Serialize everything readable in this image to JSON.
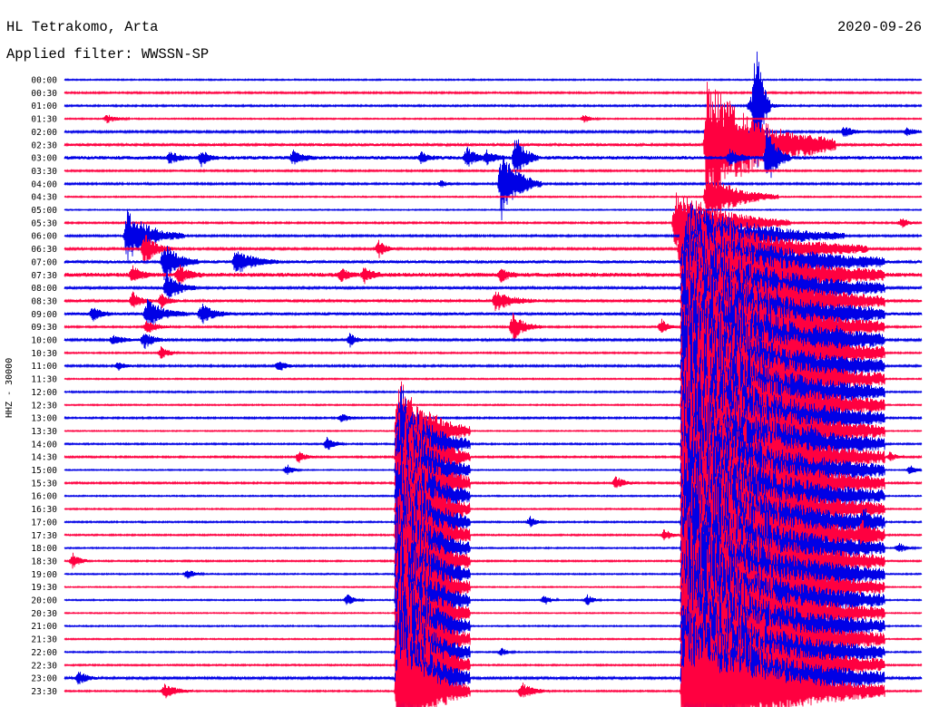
{
  "header": {
    "station": "HL Tetrakomo, Arta",
    "date": "2020-09-26",
    "filter": "Applied filter: WWSSN-SP"
  },
  "chart_data": {
    "type": "line",
    "ylabel": "HHZ - 30000",
    "colors": [
      "#0000e6",
      "#ff0040"
    ],
    "x_range_minutes": [
      0,
      30
    ],
    "rows": [
      "00:00",
      "00:30",
      "01:00",
      "01:30",
      "02:00",
      "02:30",
      "03:00",
      "03:30",
      "04:00",
      "04:30",
      "05:00",
      "05:30",
      "06:00",
      "06:30",
      "07:00",
      "07:30",
      "08:00",
      "08:30",
      "09:00",
      "09:30",
      "10:00",
      "10:30",
      "11:00",
      "11:30",
      "12:00",
      "12:30",
      "13:00",
      "13:30",
      "14:00",
      "14:30",
      "15:00",
      "15:30",
      "16:00",
      "16:30",
      "17:00",
      "17:30",
      "18:00",
      "18:30",
      "19:00",
      "19:30",
      "20:00",
      "20:30",
      "21:00",
      "21:30",
      "22:00",
      "22:30",
      "23:00",
      "23:30"
    ],
    "noise": [
      0.7,
      0.9,
      0.9,
      0.7,
      1.1,
      1.5,
      1.9,
      0.9,
      1.0,
      0.7,
      0.6,
      0.9,
      1.0,
      1.1,
      1.6,
      2.2,
      1.3,
      1.4,
      1.6,
      0.9,
      1.1,
      0.8,
      1.0,
      0.7,
      0.8,
      0.7,
      0.9,
      0.6,
      0.8,
      0.9,
      0.6,
      0.9,
      0.7,
      0.7,
      0.8,
      0.8,
      0.7,
      0.8,
      0.7,
      0.6,
      0.7,
      0.6,
      0.7,
      0.7,
      0.7,
      0.8,
      1.2,
      0.8
    ],
    "events": [
      {
        "row": 2,
        "minute": 24.0,
        "amplitude": 10,
        "duration_minutes": 1.2
      },
      {
        "row": 2,
        "minute": 24.2,
        "amplitude": 85,
        "duration_minutes": 0.5
      },
      {
        "row": 3,
        "minute": 1.5,
        "amplitude": 5,
        "duration_minutes": 0.8
      },
      {
        "row": 3,
        "minute": 18.2,
        "amplitude": 5,
        "duration_minutes": 0.5
      },
      {
        "row": 4,
        "minute": 27.3,
        "amplitude": 6,
        "duration_minutes": 0.8
      },
      {
        "row": 4,
        "minute": 29.5,
        "amplitude": 5,
        "duration_minutes": 0.6
      },
      {
        "row": 5,
        "minute": 26.0,
        "amplitude": 4,
        "duration_minutes": 1.0
      },
      {
        "row": 5,
        "minute": 22.5,
        "amplitude": 75,
        "duration_minutes": 4.5
      },
      {
        "row": 6,
        "minute": 8.0,
        "amplitude": 8,
        "duration_minutes": 0.8
      },
      {
        "row": 6,
        "minute": 15.8,
        "amplitude": 26,
        "duration_minutes": 0.8
      },
      {
        "row": 6,
        "minute": 14.8,
        "amplitude": 9,
        "duration_minutes": 0.6
      },
      {
        "row": 6,
        "minute": 14.1,
        "amplitude": 12,
        "duration_minutes": 0.7
      },
      {
        "row": 6,
        "minute": 12.5,
        "amplitude": 6,
        "duration_minutes": 0.6
      },
      {
        "row": 6,
        "minute": 3.7,
        "amplitude": 7,
        "duration_minutes": 0.7
      },
      {
        "row": 6,
        "minute": 4.8,
        "amplitude": 9,
        "duration_minutes": 0.6
      },
      {
        "row": 6,
        "minute": 23.3,
        "amplitude": 10,
        "duration_minutes": 0.7
      },
      {
        "row": 6,
        "minute": 24.6,
        "amplitude": 36,
        "duration_minutes": 0.8
      },
      {
        "row": 8,
        "minute": 15.3,
        "amplitude": 40,
        "duration_minutes": 1.4
      },
      {
        "row": 8,
        "minute": 13.2,
        "amplitude": 4,
        "duration_minutes": 0.4
      },
      {
        "row": 9,
        "minute": 22.5,
        "amplitude": 30,
        "duration_minutes": 2.5
      },
      {
        "row": 11,
        "minute": 21.4,
        "amplitude": 40,
        "duration_minutes": 4.0
      },
      {
        "row": 11,
        "minute": 29.3,
        "amplitude": 6,
        "duration_minutes": 0.5
      },
      {
        "row": 12,
        "minute": 2.2,
        "amplitude": 30,
        "duration_minutes": 2.0
      },
      {
        "row": 12,
        "minute": 21.8,
        "amplitude": 40,
        "duration_minutes": 5.5
      },
      {
        "row": 13,
        "minute": 2.8,
        "amplitude": 18,
        "duration_minutes": 1.0
      },
      {
        "row": 13,
        "minute": 11.0,
        "amplitude": 10,
        "duration_minutes": 0.6
      },
      {
        "row": 13,
        "minute": 21.6,
        "amplitude": 50,
        "duration_minutes": 6.5
      },
      {
        "row": 14,
        "minute": 3.5,
        "amplitude": 22,
        "duration_minutes": 1.2
      },
      {
        "row": 14,
        "minute": 6.0,
        "amplitude": 14,
        "duration_minutes": 1.5
      },
      {
        "row": 14,
        "minute": 21.7,
        "amplitude": 55,
        "duration_minutes": 7.0
      },
      {
        "row": 15,
        "minute": 2.4,
        "amplitude": 10,
        "duration_minutes": 0.7
      },
      {
        "row": 15,
        "minute": 4.0,
        "amplitude": 12,
        "duration_minutes": 0.8
      },
      {
        "row": 15,
        "minute": 9.7,
        "amplitude": 8,
        "duration_minutes": 0.6
      },
      {
        "row": 15,
        "minute": 10.5,
        "amplitude": 9,
        "duration_minutes": 0.6
      },
      {
        "row": 15,
        "minute": 15.3,
        "amplitude": 8,
        "duration_minutes": 0.6
      },
      {
        "row": 15,
        "minute": 21.7,
        "amplitude": 60,
        "duration_minutes": 7.0
      },
      {
        "row": 16,
        "minute": 3.6,
        "amplitude": 18,
        "duration_minutes": 1.0
      },
      {
        "row": 16,
        "minute": 21.7,
        "amplitude": 65,
        "duration_minutes": 7.0
      },
      {
        "row": 17,
        "minute": 2.4,
        "amplitude": 10,
        "duration_minutes": 0.7
      },
      {
        "row": 17,
        "minute": 3.4,
        "amplitude": 8,
        "duration_minutes": 0.6
      },
      {
        "row": 17,
        "minute": 15.1,
        "amplitude": 12,
        "duration_minutes": 1.4
      },
      {
        "row": 17,
        "minute": 21.7,
        "amplitude": 70,
        "duration_minutes": 7.0
      },
      {
        "row": 18,
        "minute": 1.0,
        "amplitude": 8,
        "duration_minutes": 0.7
      },
      {
        "row": 18,
        "minute": 2.9,
        "amplitude": 16,
        "duration_minutes": 1.4
      },
      {
        "row": 18,
        "minute": 4.8,
        "amplitude": 12,
        "duration_minutes": 1.0
      },
      {
        "row": 18,
        "minute": 21.7,
        "amplitude": 75,
        "duration_minutes": 7.0
      },
      {
        "row": 19,
        "minute": 2.9,
        "amplitude": 8,
        "duration_minutes": 0.8
      },
      {
        "row": 19,
        "minute": 15.7,
        "amplitude": 16,
        "duration_minutes": 1.0
      },
      {
        "row": 19,
        "minute": 20.9,
        "amplitude": 9,
        "duration_minutes": 0.5
      },
      {
        "row": 19,
        "minute": 21.7,
        "amplitude": 80,
        "duration_minutes": 7.0
      },
      {
        "row": 20,
        "minute": 1.7,
        "amplitude": 6,
        "duration_minutes": 1.0
      },
      {
        "row": 20,
        "minute": 2.8,
        "amplitude": 10,
        "duration_minutes": 0.8
      },
      {
        "row": 20,
        "minute": 10.0,
        "amplitude": 8,
        "duration_minutes": 0.5
      },
      {
        "row": 20,
        "minute": 21.7,
        "amplitude": 85,
        "duration_minutes": 7.0
      },
      {
        "row": 20,
        "minute": 27.0,
        "amplitude": 6,
        "duration_minutes": 0.6
      },
      {
        "row": 21,
        "minute": 3.4,
        "amplitude": 8,
        "duration_minutes": 0.6
      },
      {
        "row": 21,
        "minute": 21.7,
        "amplitude": 85,
        "duration_minutes": 7.0
      },
      {
        "row": 22,
        "minute": 1.9,
        "amplitude": 5,
        "duration_minutes": 0.5
      },
      {
        "row": 22,
        "minute": 7.5,
        "amplitude": 7,
        "duration_minutes": 0.6
      },
      {
        "row": 22,
        "minute": 21.7,
        "amplitude": 85,
        "duration_minutes": 7.0
      },
      {
        "row": 23,
        "minute": 21.7,
        "amplitude": 85,
        "duration_minutes": 7.0
      },
      {
        "row": 24,
        "minute": 21.7,
        "amplitude": 85,
        "duration_minutes": 7.0
      },
      {
        "row": 25,
        "minute": 21.7,
        "amplitude": 85,
        "duration_minutes": 7.0
      },
      {
        "row": 26,
        "minute": 9.7,
        "amplitude": 6,
        "duration_minutes": 0.6
      },
      {
        "row": 26,
        "minute": 21.7,
        "amplitude": 85,
        "duration_minutes": 7.0
      },
      {
        "row": 27,
        "minute": 11.7,
        "amplitude": 70,
        "duration_minutes": 2.5
      },
      {
        "row": 27,
        "minute": 21.7,
        "amplitude": 85,
        "duration_minutes": 7.0
      },
      {
        "row": 28,
        "minute": 9.2,
        "amplitude": 8,
        "duration_minutes": 0.6
      },
      {
        "row": 28,
        "minute": 11.7,
        "amplitude": 70,
        "duration_minutes": 2.5
      },
      {
        "row": 28,
        "minute": 21.7,
        "amplitude": 85,
        "duration_minutes": 7.0
      },
      {
        "row": 28,
        "minute": 26.1,
        "amplitude": 8,
        "duration_minutes": 0.5
      },
      {
        "row": 29,
        "minute": 8.2,
        "amplitude": 7,
        "duration_minutes": 0.6
      },
      {
        "row": 29,
        "minute": 11.7,
        "amplitude": 75,
        "duration_minutes": 2.5
      },
      {
        "row": 29,
        "minute": 21.7,
        "amplitude": 85,
        "duration_minutes": 7.0
      },
      {
        "row": 29,
        "minute": 28.9,
        "amplitude": 6,
        "duration_minutes": 0.5
      },
      {
        "row": 30,
        "minute": 7.8,
        "amplitude": 7,
        "duration_minutes": 0.5
      },
      {
        "row": 30,
        "minute": 11.7,
        "amplitude": 80,
        "duration_minutes": 2.5
      },
      {
        "row": 30,
        "minute": 21.7,
        "amplitude": 85,
        "duration_minutes": 7.0
      },
      {
        "row": 30,
        "minute": 29.6,
        "amplitude": 6,
        "duration_minutes": 0.5
      },
      {
        "row": 31,
        "minute": 11.7,
        "amplitude": 85,
        "duration_minutes": 2.5
      },
      {
        "row": 31,
        "minute": 19.3,
        "amplitude": 8,
        "duration_minutes": 0.7
      },
      {
        "row": 31,
        "minute": 21.7,
        "amplitude": 85,
        "duration_minutes": 7.0
      },
      {
        "row": 32,
        "minute": 11.7,
        "amplitude": 85,
        "duration_minutes": 2.5
      },
      {
        "row": 32,
        "minute": 21.7,
        "amplitude": 85,
        "duration_minutes": 7.0
      },
      {
        "row": 33,
        "minute": 11.7,
        "amplitude": 85,
        "duration_minutes": 2.5
      },
      {
        "row": 33,
        "minute": 21.7,
        "amplitude": 85,
        "duration_minutes": 7.0
      },
      {
        "row": 34,
        "minute": 11.7,
        "amplitude": 85,
        "duration_minutes": 2.5
      },
      {
        "row": 34,
        "minute": 16.3,
        "amplitude": 6,
        "duration_minutes": 0.5
      },
      {
        "row": 34,
        "minute": 21.7,
        "amplitude": 85,
        "duration_minutes": 7.0
      },
      {
        "row": 34,
        "minute": 28.0,
        "amplitude": 8,
        "duration_minutes": 0.7
      },
      {
        "row": 35,
        "minute": 11.7,
        "amplitude": 85,
        "duration_minutes": 2.5
      },
      {
        "row": 35,
        "minute": 21.0,
        "amplitude": 7,
        "duration_minutes": 0.6
      },
      {
        "row": 35,
        "minute": 21.7,
        "amplitude": 85,
        "duration_minutes": 7.0
      },
      {
        "row": 35,
        "minute": 27.9,
        "amplitude": 9,
        "duration_minutes": 0.8
      },
      {
        "row": 36,
        "minute": 11.7,
        "amplitude": 85,
        "duration_minutes": 2.5
      },
      {
        "row": 36,
        "minute": 21.7,
        "amplitude": 85,
        "duration_minutes": 7.0
      },
      {
        "row": 36,
        "minute": 29.2,
        "amplitude": 6,
        "duration_minutes": 0.6
      },
      {
        "row": 37,
        "minute": 0.3,
        "amplitude": 9,
        "duration_minutes": 0.6
      },
      {
        "row": 37,
        "minute": 11.7,
        "amplitude": 85,
        "duration_minutes": 2.5
      },
      {
        "row": 37,
        "minute": 21.7,
        "amplitude": 85,
        "duration_minutes": 7.0
      },
      {
        "row": 38,
        "minute": 4.3,
        "amplitude": 6,
        "duration_minutes": 0.6
      },
      {
        "row": 38,
        "minute": 11.7,
        "amplitude": 85,
        "duration_minutes": 2.5
      },
      {
        "row": 38,
        "minute": 21.7,
        "amplitude": 85,
        "duration_minutes": 7.0
      },
      {
        "row": 39,
        "minute": 11.7,
        "amplitude": 85,
        "duration_minutes": 2.5
      },
      {
        "row": 39,
        "minute": 21.7,
        "amplitude": 85,
        "duration_minutes": 7.0
      },
      {
        "row": 40,
        "minute": 9.9,
        "amplitude": 7,
        "duration_minutes": 0.6
      },
      {
        "row": 40,
        "minute": 11.7,
        "amplitude": 85,
        "duration_minutes": 2.5
      },
      {
        "row": 40,
        "minute": 16.8,
        "amplitude": 6,
        "duration_minutes": 0.5
      },
      {
        "row": 40,
        "minute": 18.3,
        "amplitude": 6,
        "duration_minutes": 0.5
      },
      {
        "row": 40,
        "minute": 21.7,
        "amplitude": 85,
        "duration_minutes": 7.0
      },
      {
        "row": 41,
        "minute": 11.7,
        "amplitude": 85,
        "duration_minutes": 2.5
      },
      {
        "row": 41,
        "minute": 21.7,
        "amplitude": 85,
        "duration_minutes": 7.0
      },
      {
        "row": 42,
        "minute": 11.7,
        "amplitude": 85,
        "duration_minutes": 2.5
      },
      {
        "row": 42,
        "minute": 21.7,
        "amplitude": 85,
        "duration_minutes": 7.0
      },
      {
        "row": 43,
        "minute": 11.7,
        "amplitude": 85,
        "duration_minutes": 2.5
      },
      {
        "row": 43,
        "minute": 21.7,
        "amplitude": 85,
        "duration_minutes": 7.0
      },
      {
        "row": 44,
        "minute": 11.7,
        "amplitude": 85,
        "duration_minutes": 2.5
      },
      {
        "row": 44,
        "minute": 15.3,
        "amplitude": 5,
        "duration_minutes": 0.5
      },
      {
        "row": 44,
        "minute": 21.7,
        "amplitude": 85,
        "duration_minutes": 7.0
      },
      {
        "row": 45,
        "minute": 11.7,
        "amplitude": 85,
        "duration_minutes": 2.5
      },
      {
        "row": 45,
        "minute": 21.7,
        "amplitude": 85,
        "duration_minutes": 7.0
      },
      {
        "row": 46,
        "minute": 0.5,
        "amplitude": 8,
        "duration_minutes": 0.7
      },
      {
        "row": 46,
        "minute": 11.7,
        "amplitude": 85,
        "duration_minutes": 2.5
      },
      {
        "row": 46,
        "minute": 21.7,
        "amplitude": 85,
        "duration_minutes": 7.0
      },
      {
        "row": 46,
        "minute": 22.8,
        "amplitude": 10,
        "duration_minutes": 1.5
      },
      {
        "row": 47,
        "minute": 3.5,
        "amplitude": 9,
        "duration_minutes": 1.0
      },
      {
        "row": 47,
        "minute": 11.7,
        "amplitude": 85,
        "duration_minutes": 2.5
      },
      {
        "row": 47,
        "minute": 16.0,
        "amplitude": 10,
        "duration_minutes": 1.0
      },
      {
        "row": 47,
        "minute": 21.7,
        "amplitude": 85,
        "duration_minutes": 7.0
      }
    ]
  }
}
